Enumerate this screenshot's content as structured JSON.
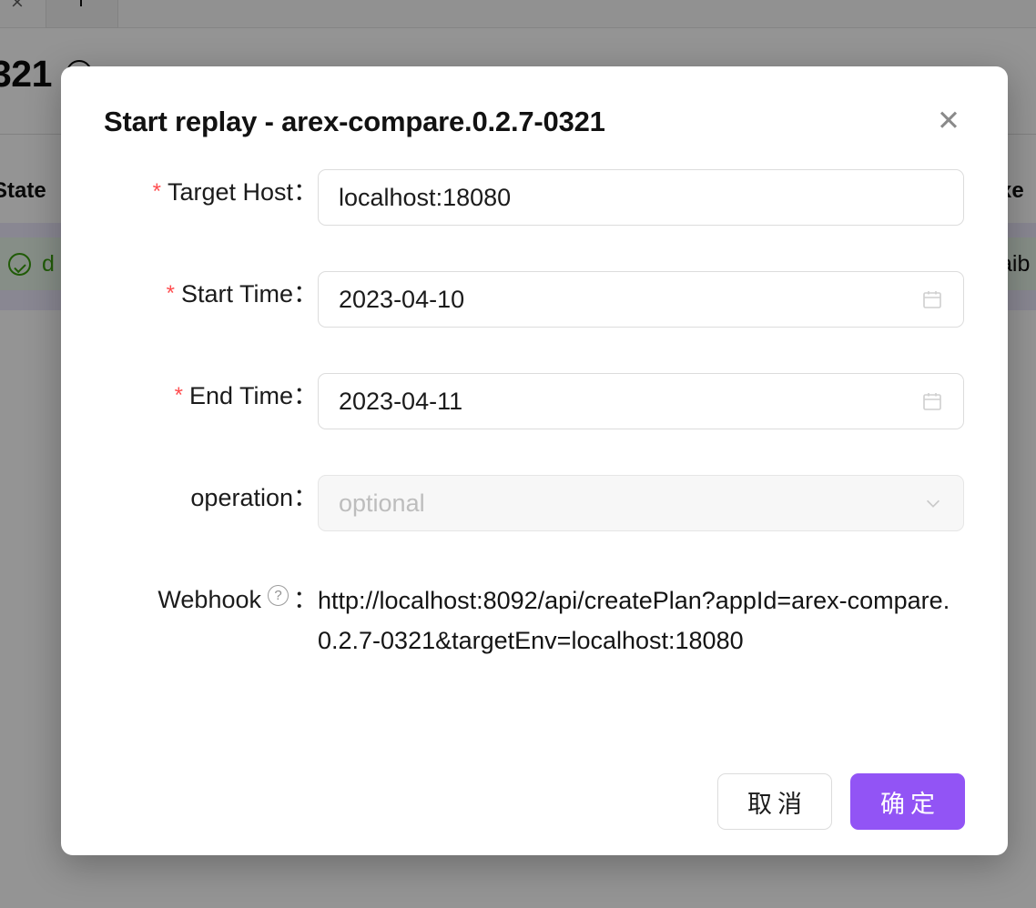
{
  "background": {
    "tab_close_icon": "×",
    "page_title_fragment": "321",
    "column_header_state": "State",
    "column_header_right_fragment": "xe",
    "row_status_label": "d",
    "row_right_fragment": "aib",
    "status_icon": "check-circle-icon"
  },
  "modal": {
    "title": "Start replay - arex-compare.0.2.7-0321",
    "close_icon": "✕",
    "fields": [
      {
        "key": "target_host",
        "required": true,
        "label": "Target Host",
        "colon": "：",
        "value": "localhost:18080",
        "placeholder": "",
        "control": "input"
      },
      {
        "key": "start_time",
        "required": true,
        "label": "Start Time",
        "colon": "：",
        "value": "2023-04-10",
        "placeholder": "",
        "control": "date",
        "suffix_icon": "calendar-icon"
      },
      {
        "key": "end_time",
        "required": true,
        "label": "End Time",
        "colon": "：",
        "value": "2023-04-11",
        "placeholder": "",
        "control": "date",
        "suffix_icon": "calendar-icon"
      },
      {
        "key": "operation",
        "required": false,
        "label": "operation",
        "colon": "：",
        "value": "",
        "placeholder": "optional",
        "control": "select",
        "disabled": true,
        "suffix_icon": "chevron-down-icon"
      },
      {
        "key": "webhook",
        "required": false,
        "label": "Webhook",
        "colon": "：",
        "help_icon": "question-circle-icon",
        "value": "http://localhost:8092/api/createPlan?appId=arex-compare.0.2.7-0321&targetEnv=localhost:18080",
        "control": "text"
      }
    ],
    "footer": {
      "cancel_label": "取消",
      "confirm_label": "确定"
    }
  },
  "colors": {
    "primary": "#9254f5",
    "required_star": "#ff4d4f",
    "success": "#389e0d",
    "overlay": "rgba(0,0,0,0.42)",
    "text": "#1b1b1b",
    "placeholder": "#bdbdbd"
  }
}
